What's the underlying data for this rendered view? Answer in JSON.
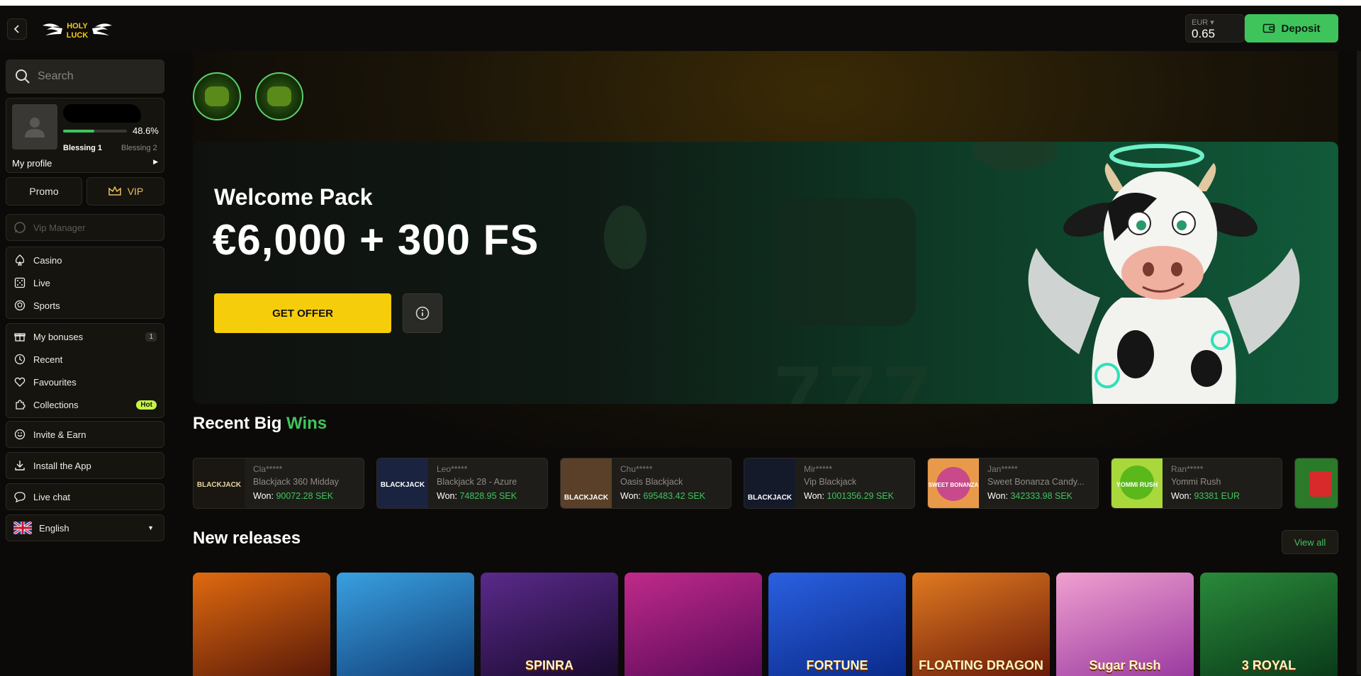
{
  "header": {
    "logo_text": "HOLY LUCK",
    "currency": "EUR ▾",
    "balance": "0.65",
    "deposit_label": "Deposit"
  },
  "sidebar": {
    "search_placeholder": "Search",
    "profile": {
      "progress_pct": "48.6%",
      "progress_value": 0.486,
      "level_current": "Blessing 1",
      "level_next": "Blessing 2",
      "my_profile_label": "My profile"
    },
    "promo_label": "Promo",
    "vip_label": "VIP",
    "vip_manager_label": "Vip Manager",
    "nav_main": [
      {
        "label": "Casino",
        "icon": "spade-icon"
      },
      {
        "label": "Live",
        "icon": "dice-icon"
      },
      {
        "label": "Sports",
        "icon": "ball-icon"
      }
    ],
    "nav_personal": [
      {
        "label": "My bonuses",
        "icon": "gift-icon",
        "badge": "1"
      },
      {
        "label": "Recent",
        "icon": "clock-icon"
      },
      {
        "label": "Favourites",
        "icon": "heart-icon"
      },
      {
        "label": "Collections",
        "icon": "puzzle-icon",
        "badge": "Hot"
      }
    ],
    "invite_label": "Invite & Earn",
    "install_label": "Install the App",
    "live_chat_label": "Live chat",
    "language_label": "English"
  },
  "hero": {
    "title": "Welcome Pack",
    "offer": "€6,000 + 300 FS",
    "cta_label": "GET OFFER"
  },
  "recent_wins": {
    "title_part1": "Recent Big",
    "title_part2": "Wins",
    "items": [
      {
        "user": "Cla*****",
        "game": "Blackjack 360 Midday",
        "won_label": "Won:",
        "amount": "90072.28 SEK",
        "thumb": "BLACKJACK"
      },
      {
        "user": "Leo*****",
        "game": "Blackjack 28 - Azure",
        "won_label": "Won:",
        "amount": "74828.95 SEK",
        "thumb": "BLACKJACK"
      },
      {
        "user": "Chu*****",
        "game": "Oasis Blackjack",
        "won_label": "Won:",
        "amount": "695483.42 SEK",
        "thumb": "BLACKJACK"
      },
      {
        "user": "Mir*****",
        "game": "Vip Blackjack",
        "won_label": "Won:",
        "amount": "1001356.29 SEK",
        "thumb": "BLACKJACK"
      },
      {
        "user": "Jan*****",
        "game": "Sweet Bonanza Candy...",
        "won_label": "Won:",
        "amount": "342333.98 SEK",
        "thumb": "SWEET BONANZA"
      },
      {
        "user": "Ran*****",
        "game": "Yommi Rush",
        "won_label": "Won:",
        "amount": "93381 EUR",
        "thumb": "YOMMI RUSH"
      }
    ]
  },
  "new_releases": {
    "title": "New releases",
    "view_all_label": "View all",
    "items": [
      {
        "name": "",
        "color1": "#e06a10",
        "color2": "#5a1a08"
      },
      {
        "name": "",
        "color1": "#3aa0e0",
        "color2": "#10407a"
      },
      {
        "name": "SPINRA",
        "color1": "#5a2a8a",
        "color2": "#1a0a30"
      },
      {
        "name": "",
        "color1": "#c02a8a",
        "color2": "#5a0a5a"
      },
      {
        "name": "FORTUNE",
        "color1": "#2a60e0",
        "color2": "#0a2a8a"
      },
      {
        "name": "FLOATING DRAGON",
        "color1": "#e07a20",
        "color2": "#6a1a0a"
      },
      {
        "name": "Sugar Rush",
        "color1": "#f0a0d0",
        "color2": "#9a3aa0"
      },
      {
        "name": "3 ROYAL",
        "color1": "#2a8a3a",
        "color2": "#0a3a1a"
      }
    ]
  }
}
